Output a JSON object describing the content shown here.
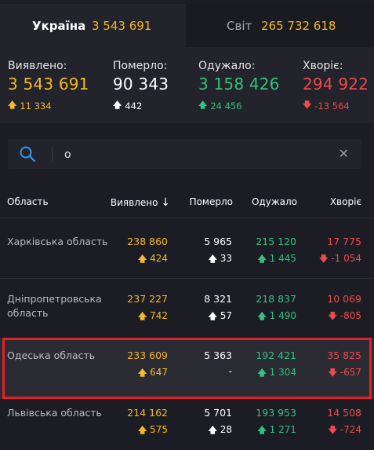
{
  "tabs": {
    "ukraine": {
      "label": "Україна",
      "value": "3 543 691"
    },
    "world": {
      "label": "Світ",
      "value": "265 732 618"
    }
  },
  "stats": {
    "detected": {
      "label": "Виявлено:",
      "value": "3 543 691",
      "delta": "11 334",
      "color": "#f5b72b"
    },
    "deaths": {
      "label": "Померло:",
      "value": "90 343",
      "delta": "442",
      "color": "#ffffff"
    },
    "recovered": {
      "label": "Одужало:",
      "value": "3 158 426",
      "delta": "24 456",
      "color": "#34c07c"
    },
    "sick": {
      "label": "Хворіє:",
      "value": "294 922",
      "delta": "-13 564",
      "color": "#ee4a4a"
    }
  },
  "search": {
    "value": "о",
    "icon": "search-icon",
    "clear_icon": "close-icon"
  },
  "table": {
    "headers": {
      "region": "Область",
      "detected": "Виявлено",
      "detected_sort_icon": "↓",
      "deaths": "Померло",
      "recovered": "Одужало",
      "sick": "Хворіє"
    },
    "rows": [
      {
        "region": "Харківська область",
        "detected": "238 860",
        "detected_delta": "424",
        "deaths": "5 965",
        "deaths_delta": "33",
        "recovered": "215 120",
        "recovered_delta": "1 445",
        "sick": "17 775",
        "sick_delta": "-1 054"
      },
      {
        "region": "Дніпропетровська область",
        "detected": "237 227",
        "detected_delta": "742",
        "deaths": "8 321",
        "deaths_delta": "57",
        "recovered": "218 837",
        "recovered_delta": "1 490",
        "sick": "10 069",
        "sick_delta": "-805"
      },
      {
        "region": "Одеська область",
        "detected": "233 609",
        "detected_delta": "647",
        "deaths": "5 363",
        "deaths_delta": "-",
        "recovered": "192 421",
        "recovered_delta": "1 304",
        "sick": "35 825",
        "sick_delta": "-657",
        "highlighted": true
      },
      {
        "region": "Львівська область",
        "detected": "214 162",
        "detected_delta": "575",
        "deaths": "5 701",
        "deaths_delta": "28",
        "recovered": "193 953",
        "recovered_delta": "1 271",
        "sick": "14 508",
        "sick_delta": "-724"
      }
    ]
  },
  "colors": {
    "background": "#1c1d24",
    "panel": "#22232b",
    "yellow": "#f5b72b",
    "green": "#34c07c",
    "red": "#ee4a4a",
    "highlight_border": "#e32025"
  }
}
